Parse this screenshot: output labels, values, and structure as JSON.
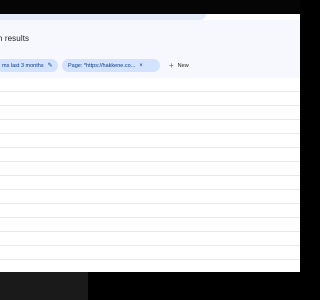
{
  "header": {
    "title": "h results",
    "chips": [
      {
        "label": "ms last 3 months",
        "icon": "edit-icon"
      },
      {
        "label": "Page: *https://hakkene.co...",
        "icon": "close-icon"
      }
    ],
    "new_filter": {
      "label": "New",
      "icon": "plus-icon"
    }
  },
  "table": {
    "row_count": 13
  },
  "colors": {
    "chip_bg": "#d3e3fd",
    "accent": "#1a73e8",
    "header_bg": "#f6f8fd"
  }
}
